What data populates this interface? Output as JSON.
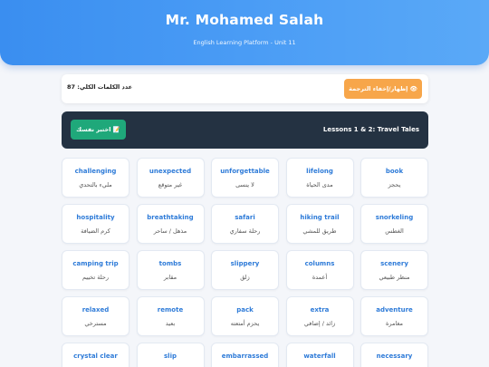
{
  "header": {
    "title": "Mr. Mohamed Salah",
    "subtitle": "English Learning Platform - Unit 11"
  },
  "stats": {
    "word_count_label": "عدد الكلمات الكلي: 87",
    "toggle_label": "👁 إظهار/إخفاء الترجمة"
  },
  "lesson": {
    "title": "Lessons 1 & 2: Travel Tales",
    "test_label": "📝 اختبر نفسك"
  },
  "words": [
    {
      "en": "challenging",
      "ar": "مليء بالتحدي"
    },
    {
      "en": "unexpected",
      "ar": "غير متوقع"
    },
    {
      "en": "unforgettable",
      "ar": "لا ينسى"
    },
    {
      "en": "lifelong",
      "ar": "مدى الحياة"
    },
    {
      "en": "book",
      "ar": "يحجز"
    },
    {
      "en": "hospitality",
      "ar": "كرم الضيافة"
    },
    {
      "en": "breathtaking",
      "ar": "مذهل / ساحر"
    },
    {
      "en": "safari",
      "ar": "رحلة سفاري"
    },
    {
      "en": "hiking trail",
      "ar": "طريق للمشي"
    },
    {
      "en": "snorkeling",
      "ar": "الغطس"
    },
    {
      "en": "camping trip",
      "ar": "رحلة تخييم"
    },
    {
      "en": "tombs",
      "ar": "مقابر"
    },
    {
      "en": "slippery",
      "ar": "زلق"
    },
    {
      "en": "columns",
      "ar": "أعمدة"
    },
    {
      "en": "scenery",
      "ar": "منظر طبيعي"
    },
    {
      "en": "relaxed",
      "ar": "مسترخي"
    },
    {
      "en": "remote",
      "ar": "بعيد"
    },
    {
      "en": "pack",
      "ar": "يحزم أمتعته"
    },
    {
      "en": "extra",
      "ar": "زائد / إضافي"
    },
    {
      "en": "adventure",
      "ar": "مغامرة"
    },
    {
      "en": "crystal clear",
      "ar": ""
    },
    {
      "en": "slip",
      "ar": ""
    },
    {
      "en": "embarrassed",
      "ar": ""
    },
    {
      "en": "waterfall",
      "ar": ""
    },
    {
      "en": "necessary",
      "ar": ""
    }
  ]
}
